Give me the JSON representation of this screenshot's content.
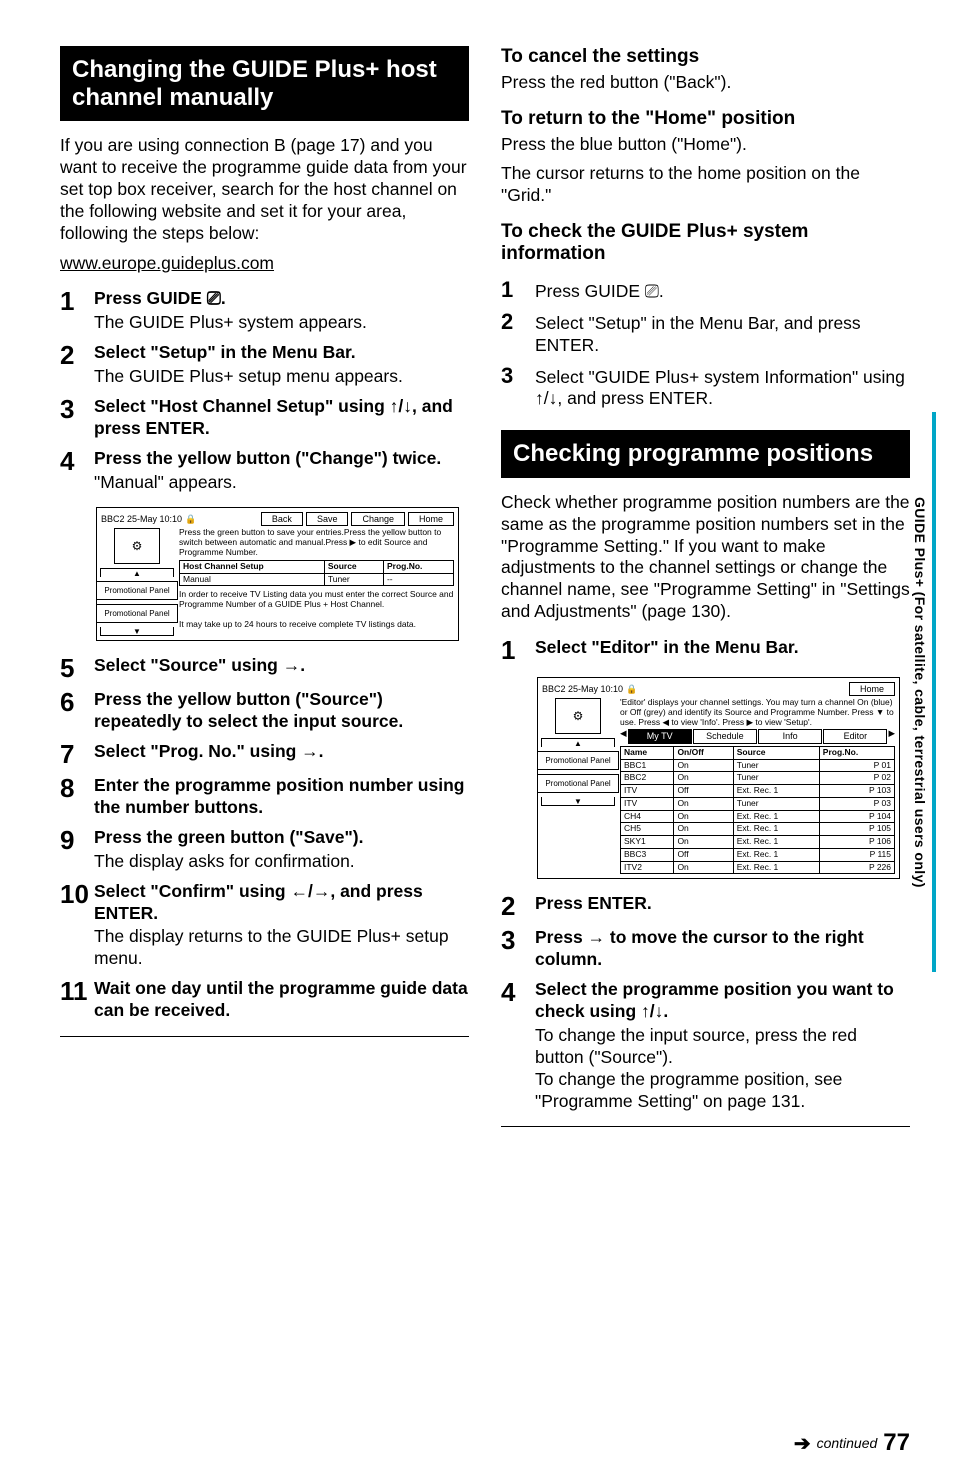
{
  "left": {
    "banner": "Changing the GUIDE Plus+ host channel manually",
    "intro": "If you are using connection B (page 17) and you want to receive the programme guide data from your set top box receiver, search for the host channel on the following website and set it for your area, following the steps below:",
    "url": "www.europe.guideplus.com",
    "steps": [
      {
        "n": "1",
        "title": "Press GUIDE ⎚.",
        "desc": "The GUIDE Plus+ system appears."
      },
      {
        "n": "2",
        "title": "Select \"Setup\" in the Menu Bar.",
        "desc": "The GUIDE Plus+ setup menu appears."
      },
      {
        "n": "3",
        "title": "Select \"Host Channel Setup\" using ↑/↓, and press ENTER.",
        "desc": ""
      },
      {
        "n": "4",
        "title": "Press the yellow button (\"Change\") twice.",
        "desc": "\"Manual\" appears."
      },
      {
        "n": "5",
        "title": "Select \"Source\" using →.",
        "desc": ""
      },
      {
        "n": "6",
        "title": "Press the yellow button (\"Source\") repeatedly to select the input source.",
        "desc": ""
      },
      {
        "n": "7",
        "title": "Select \"Prog. No.\" using →.",
        "desc": ""
      },
      {
        "n": "8",
        "title": "Enter the programme position number using the number buttons.",
        "desc": ""
      },
      {
        "n": "9",
        "title": "Press the green button (\"Save\").",
        "desc": "The display asks for confirmation."
      },
      {
        "n": "10",
        "title": "Select \"Confirm\" using ←/→, and press ENTER.",
        "desc": "The display returns to the GUIDE Plus+ setup menu."
      },
      {
        "n": "11",
        "title": "Wait one day until the programme guide data can be received.",
        "desc": ""
      }
    ],
    "shot1": {
      "topLabel": "BBC2  25-May 10:10",
      "btns": [
        "Back",
        "Save",
        "Change",
        "Home"
      ],
      "msg": "Press the green button to save your entries.Press the yellow button to switch between automatic and manual.Press ▶ to edit Source and Programme Number.",
      "cols": [
        "Host Channel Setup",
        "Source",
        "Prog.No."
      ],
      "row": [
        "Manual",
        "Tuner",
        "--"
      ],
      "panelLabel": "Promotional Panel",
      "note1": "In order to receive TV Listing data you must enter the correct Source and Programme Number of a GUIDE Plus + Host Channel.",
      "note2": "It may take up to 24 hours to receive complete TV listings data."
    }
  },
  "right": {
    "cancel_h": "To cancel the settings",
    "cancel_t": "Press the red button (\"Back\").",
    "return_h": "To return to the \"Home\" position",
    "return_t1": "Press the blue button (\"Home\").",
    "return_t2": "The cursor returns to the home position on the \"Grid.\"",
    "check_h": "To check the GUIDE Plus+ system information",
    "check_steps": [
      {
        "n": "1",
        "t": "Press GUIDE ⎚."
      },
      {
        "n": "2",
        "t": "Select \"Setup\" in the Menu Bar, and press ENTER."
      },
      {
        "n": "3",
        "t": "Select \"GUIDE Plus+ system Information\" using ↑/↓, and press ENTER."
      }
    ],
    "banner2": "Checking programme positions",
    "intro2": "Check whether programme position numbers are the same as the programme position numbers set in the \"Programme Setting.\" If you want to make adjustments to the channel settings or change the channel name, see \"Programme Setting\" in \"Settings and Adjustments\" (page 130).",
    "steps2": [
      {
        "n": "1",
        "title": "Select \"Editor\" in the Menu Bar.",
        "desc": ""
      },
      {
        "n": "2",
        "title": "Press ENTER.",
        "desc": ""
      },
      {
        "n": "3",
        "title": "Press → to move the cursor to the right column.",
        "desc": ""
      },
      {
        "n": "4",
        "title": "Select the programme position you want to check using ↑/↓.",
        "desc": "To change the input source, press the red button (\"Source\").\nTo change the programme position, see \"Programme Setting\" on page 131."
      }
    ],
    "shot2": {
      "topLabel": "BBC2  25-May 10:10",
      "homeBtn": "Home",
      "msg": "'Editor' displays your channel settings. You may turn a channel On (blue) or Off (grey) and identify its Source and Programme Number. Press ▼ to use. Press ◀ to view 'Info'. Press ▶ to view 'Setup'.",
      "tabs": [
        "My TV",
        "Schedule",
        "Info",
        "Editor"
      ],
      "head": [
        "Name",
        "On/Off",
        "Source",
        "Prog.No."
      ],
      "rows": [
        [
          "BBC1",
          "On",
          "Tuner",
          "P  01"
        ],
        [
          "BBC2",
          "On",
          "Tuner",
          "P  02"
        ],
        [
          "ITV",
          "Off",
          "Ext. Rec. 1",
          "P 103"
        ],
        [
          "ITV",
          "On",
          "Tuner",
          "P  03"
        ],
        [
          "CH4",
          "On",
          "Ext. Rec. 1",
          "P 104"
        ],
        [
          "CH5",
          "On",
          "Ext. Rec. 1",
          "P 105"
        ],
        [
          "SKY1",
          "On",
          "Ext. Rec. 1",
          "P 106"
        ],
        [
          "BBC3",
          "Off",
          "Ext. Rec. 1",
          "P 115"
        ],
        [
          "ITV2",
          "On",
          "Ext. Rec. 1",
          "P 226"
        ]
      ],
      "panelLabel": "Promotional Panel"
    }
  },
  "sideTab": "GUIDE Plus+ (For satellite, cable, terrestrial users only)",
  "footer": {
    "cont": "continued",
    "page": "77"
  }
}
